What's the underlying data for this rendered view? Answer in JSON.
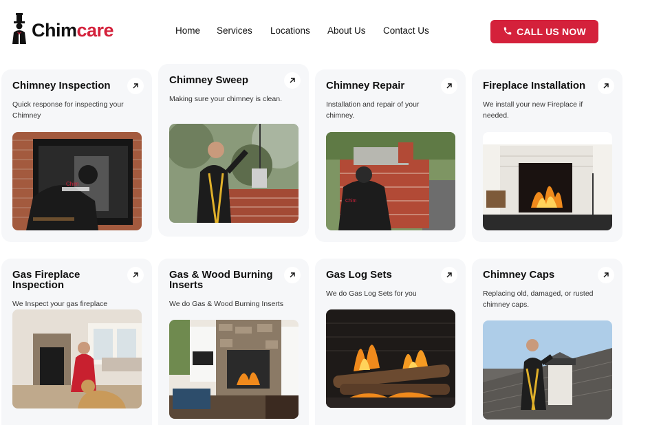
{
  "brand": {
    "name_part1": "Chim",
    "name_part2": "care",
    "accent": "#d4213b"
  },
  "nav": {
    "items": [
      {
        "label": "Home"
      },
      {
        "label": "Services"
      },
      {
        "label": "Locations"
      },
      {
        "label": "About Us"
      },
      {
        "label": "Contact Us"
      }
    ]
  },
  "cta": {
    "label": "CALL US NOW",
    "icon": "phone-icon"
  },
  "cards": [
    {
      "title": "Chimney Inspection",
      "desc": "Quick response for inspecting your Chimney",
      "image": "technician inspecting fireplace"
    },
    {
      "title": "Chimney Sweep",
      "desc": "Making sure your chimney is clean.",
      "image": "worker sweeping chimney on roof"
    },
    {
      "title": "Chimney Repair",
      "desc": "Installation and repair of your chimney.",
      "image": "technician repairing brick chimney"
    },
    {
      "title": "Fireplace Installation",
      "desc": "We install your new Fireplace if needed.",
      "image": "white fireplace with fire"
    },
    {
      "title": "Gas Fireplace Inspection",
      "desc": "We Inspect your gas fireplace",
      "image": "technician with dog at fireplace"
    },
    {
      "title": "Gas & Wood Burning Inserts",
      "desc": "We do Gas & Wood Burning Inserts",
      "image": "stone fireplace insert in living room"
    },
    {
      "title": "Gas Log Sets",
      "desc": "We do Gas Log Sets for you",
      "image": "burning gas log set"
    },
    {
      "title": "Chimney Caps",
      "desc": "Replacing old, damaged, or rusted chimney caps.",
      "image": "worker installing chimney cap on roof"
    }
  ]
}
